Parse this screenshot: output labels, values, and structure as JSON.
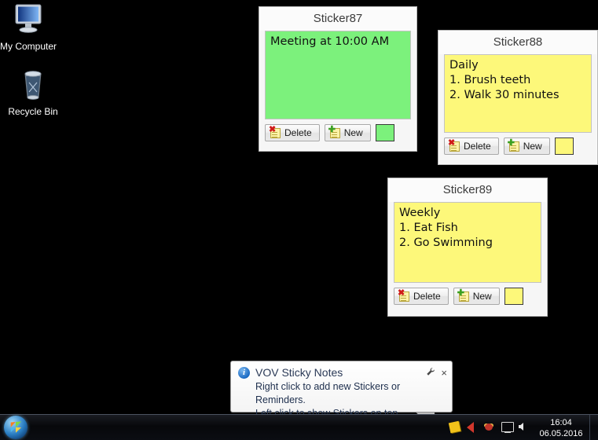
{
  "desktop": {
    "icons": [
      {
        "name": "My Computer",
        "icon": "monitor-icon"
      },
      {
        "name": "Recycle Bin",
        "icon": "trash-icon"
      }
    ]
  },
  "stickers": [
    {
      "id": "sticker87",
      "title": "Sticker87",
      "text": "Meeting at 10:00 AM",
      "color": "#7cf17c",
      "delete_label": "Delete",
      "new_label": "New"
    },
    {
      "id": "sticker88",
      "title": "Sticker88",
      "text": "Daily\n1. Brush teeth\n2. Walk 30 minutes",
      "color": "#fdf87a",
      "delete_label": "Delete",
      "new_label": "New"
    },
    {
      "id": "sticker89",
      "title": "Sticker89",
      "text": "Weekly\n1. Eat Fish\n2. Go Swimming",
      "color": "#fdf87a",
      "delete_label": "Delete",
      "new_label": "New"
    }
  ],
  "balloon": {
    "title": "VOV  Sticky Notes",
    "body": "Right click to add new Stickers or Reminders.\nLeft click to show Stickers on top.",
    "info_icon": "i",
    "options_icon": "options-wrench-icon",
    "close_icon": "×"
  },
  "taskbar": {
    "start_icon": "windows-start-orb",
    "tray_icons": [
      "sticky-notes-tray-icon",
      "media-speaker-tray-icon",
      "antivirus-tray-icon",
      "network-tray-icon",
      "volume-tray-icon"
    ],
    "clock": {
      "time": "16:04",
      "date": "06.05.2016"
    }
  }
}
